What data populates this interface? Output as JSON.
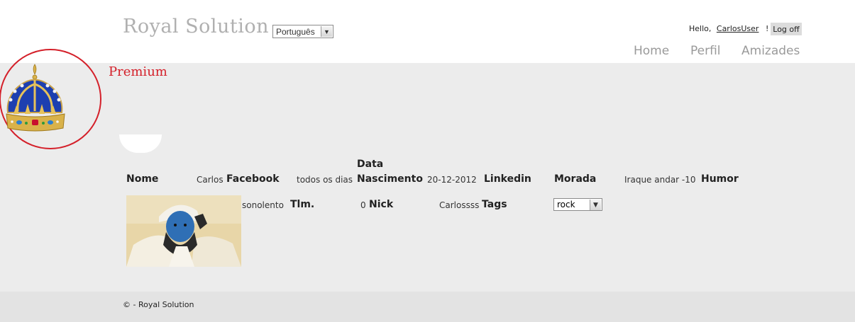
{
  "header": {
    "site_title": "Royal Solution",
    "language_selected": "Português",
    "greeting": "Hello,",
    "username": "CarlosUser",
    "exclamation": "!",
    "logoff_label": "Log off",
    "nav": [
      "Home",
      "Perfil",
      "Amizades"
    ]
  },
  "badge": {
    "premium_label": "Premium",
    "logo": "crown-icon"
  },
  "profile": {
    "labels": {
      "nome": "Nome",
      "facebook": "Facebook",
      "data": "Data",
      "nascimento": "Nascimento",
      "linkedin": "Linkedin",
      "morada": "Morada",
      "humor": "Humor",
      "tlm": "Tlm.",
      "nick": "Nick",
      "tags": "Tags"
    },
    "values": {
      "nome": "Carlos",
      "facebook": "todos os dias",
      "nascimento": "20-12-2012",
      "morada": "Iraque andar -10",
      "humor": "sonolento",
      "tlm": "0",
      "nick": "Carlossss",
      "tags_selected": "rock"
    }
  },
  "footer": {
    "copyright": "© - Royal Solution"
  },
  "colors": {
    "premium": "#d4202a",
    "main_bg": "#ececec",
    "circle": "#d4202a"
  }
}
